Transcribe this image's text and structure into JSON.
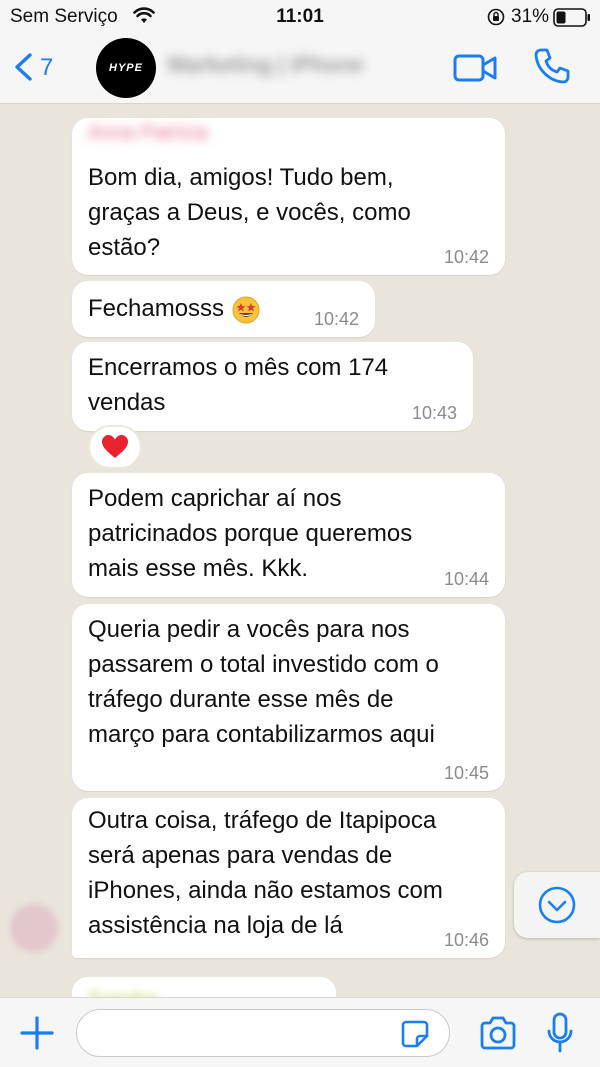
{
  "status_bar": {
    "carrier": "Sem Serviço",
    "time": "11:01",
    "battery": "31%",
    "icons": [
      "wifi-icon",
      "orientation-lock-icon",
      "battery-icon"
    ]
  },
  "header": {
    "back_count": "7",
    "avatar_text": "HYPE",
    "contact_name": "Marketing | iPhone",
    "icons": [
      "chevron-left-icon",
      "video-icon",
      "phone-icon"
    ]
  },
  "colors": {
    "accent": "#1a7ef2",
    "chat_background": "#e9e4dc",
    "bubble": "#ffffff",
    "timestamp": "#8c8c8c",
    "heart": "#e8232e"
  },
  "chat": {
    "sender_name": "Anna Patrícia",
    "messages": [
      {
        "lines": [
          "Bom dia, amigos! Tudo bem,",
          "graças a Deus, e vocês, como",
          "estão?"
        ],
        "time": "10:42"
      },
      {
        "text": "Fechamosss",
        "emoji": "star-struck-emoji-icon",
        "time": "10:42"
      },
      {
        "lines": [
          "Encerramos o mês com 174",
          "vendas"
        ],
        "time": "10:43",
        "reaction": "heart-icon"
      },
      {
        "lines": [
          "Podem caprichar aí nos",
          "patricinados porque queremos",
          "mais esse mês. Kkk."
        ],
        "time": "10:44"
      },
      {
        "lines": [
          "Queria pedir a vocês para nos",
          "passarem o total investido com o",
          "tráfego durante esse mês de",
          "março para contabilizarmos aqui"
        ],
        "time": "10:45"
      },
      {
        "lines": [
          "Outra coisa, tráfego de Itapipoca",
          "será apenas para vendas de",
          "iPhones, ainda não estamos com",
          "assistência na loja de lá"
        ],
        "time": "10:46"
      }
    ],
    "next_partial_sender": "Sandra"
  },
  "input_bar": {
    "placeholder": "",
    "icons": [
      "plus-icon",
      "sticker-icon",
      "camera-icon",
      "microphone-icon"
    ]
  }
}
